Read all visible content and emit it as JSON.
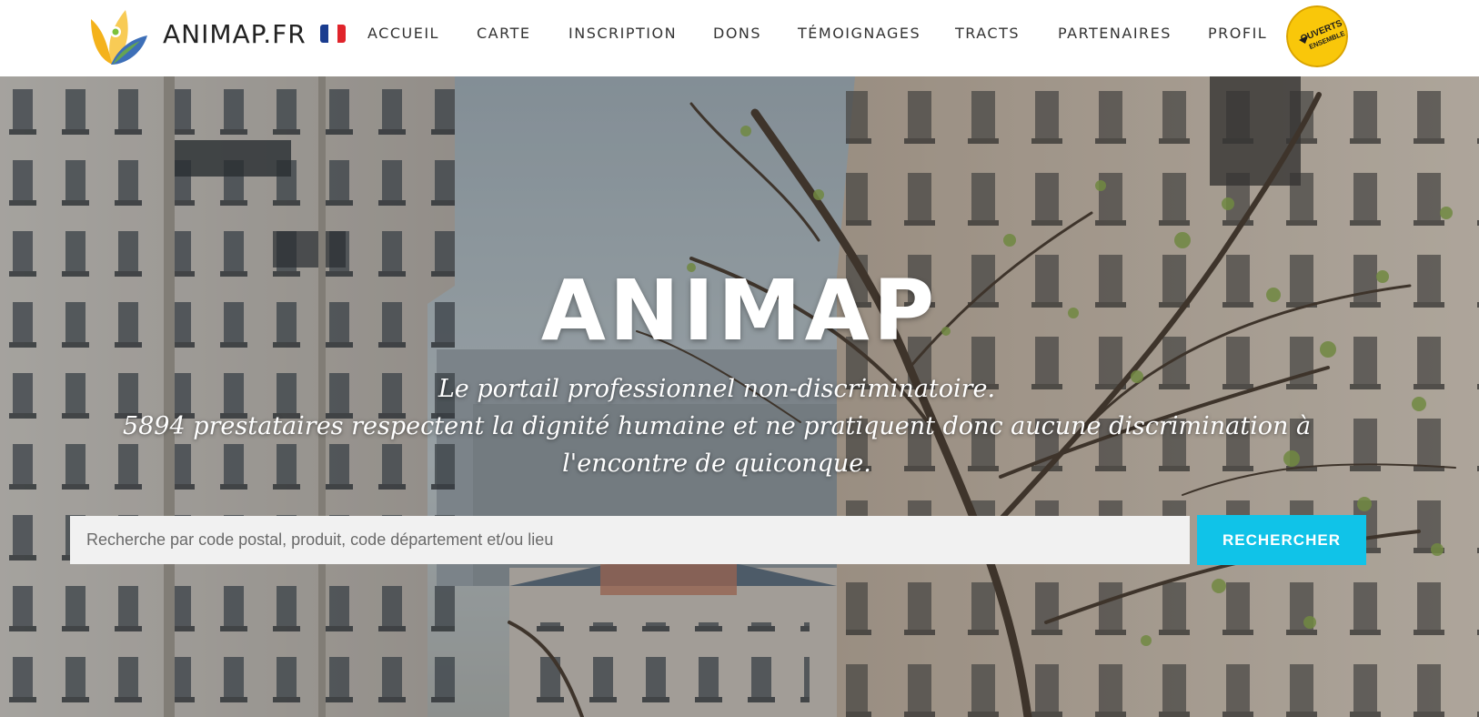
{
  "brand": {
    "name": "ANIMAP.FR",
    "flag_colors": [
      "#1a3c8f",
      "#ffffff",
      "#e0242b"
    ]
  },
  "nav": {
    "items": [
      {
        "label": "ACCUEIL"
      },
      {
        "label": "CARTE"
      },
      {
        "label": "INSCRIPTION"
      },
      {
        "label": "DONS"
      },
      {
        "label": "TÉMOIGNAGES"
      },
      {
        "label": "TRACTS"
      },
      {
        "label": "PARTENAIRES"
      },
      {
        "label": "PROFIL"
      }
    ]
  },
  "badge": {
    "line1": "OUVERTS",
    "line2": "ENSEMBLE",
    "color": "#f9c70a"
  },
  "hero": {
    "title": "ANIMAP",
    "subtitle_line1": "Le portail professionnel non-discriminatoire.",
    "subtitle_line2": "5894 prestataires respectent la dignité humaine et ne pratiquent donc aucune discrimination à l'encontre de quiconque."
  },
  "search": {
    "placeholder": "Recherche par code postal, produit, code département et/ou lieu",
    "button_label": "RECHERCHER",
    "button_color": "#10c3e8"
  }
}
